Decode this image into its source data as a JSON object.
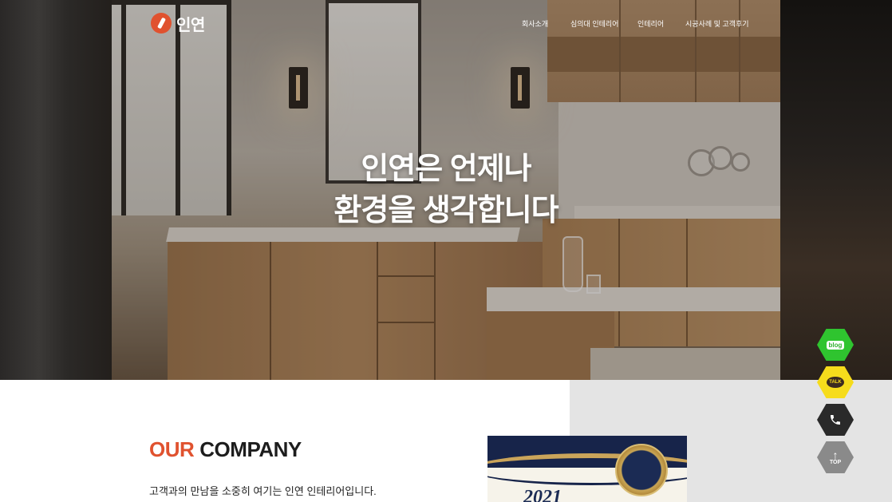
{
  "brand": {
    "name": "인연",
    "accent_color": "#e0522f"
  },
  "nav": {
    "items": [
      {
        "label": "회사소개"
      },
      {
        "label": "심의대 인테리어"
      },
      {
        "label": "인테리어"
      },
      {
        "label": "시공사례 및 고객후기"
      }
    ]
  },
  "hero": {
    "line1": "인연은 언제나",
    "line2": "환경을 생각합니다"
  },
  "company": {
    "heading_accent": "OUR",
    "heading_rest": "COMPANY",
    "subtitle": "고객과의 만남을 소중히 여기는 인연 인테리어입니다."
  },
  "award": {
    "year": "2021"
  },
  "floating": {
    "blog_label": "blog",
    "talk_label": "TALK",
    "phone_icon": "phone-icon",
    "top_label": "TOP",
    "colors": {
      "blog": "#2fc42f",
      "talk": "#f6dc1c",
      "phone": "#2a2a2a",
      "top": "#8a8a8a"
    }
  }
}
